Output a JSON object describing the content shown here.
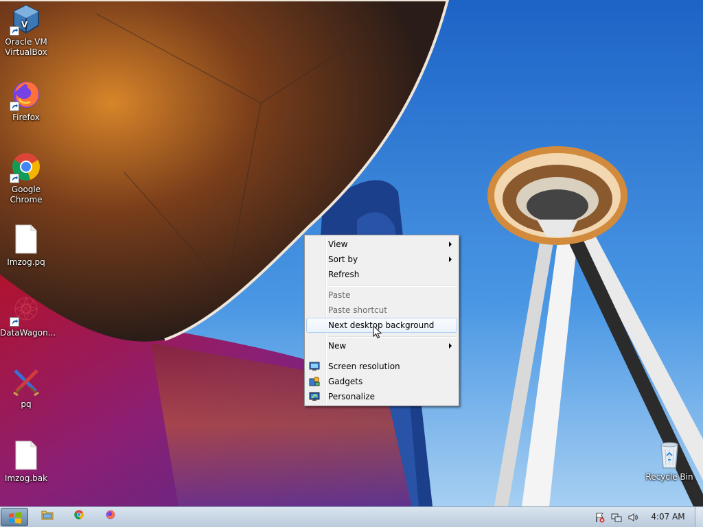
{
  "desktop": {
    "icons": [
      {
        "label_lines": [
          "Oracle VM",
          "VirtualBox"
        ],
        "icon": "virtualbox-icon",
        "shortcut": true
      },
      {
        "label_lines": [
          "Firefox"
        ],
        "icon": "firefox-icon",
        "shortcut": true
      },
      {
        "label_lines": [
          "Google",
          "Chrome"
        ],
        "icon": "chrome-icon",
        "shortcut": true
      },
      {
        "label_lines": [
          "Imzog.pq"
        ],
        "icon": "file-icon",
        "shortcut": false
      },
      {
        "label_lines": [
          "DataWagon..."
        ],
        "icon": "datawagon-icon",
        "shortcut": true
      },
      {
        "label_lines": [
          "pq"
        ],
        "icon": "pq-swords-icon",
        "shortcut": false
      },
      {
        "label_lines": [
          "Imzog.bak"
        ],
        "icon": "file-icon",
        "shortcut": false
      },
      {
        "label_lines": [
          "Recycle Bin"
        ],
        "icon": "recycle-bin-icon",
        "shortcut": false
      }
    ]
  },
  "context_menu": {
    "items": [
      {
        "label": "View",
        "submenu": true,
        "enabled": true
      },
      {
        "label": "Sort by",
        "submenu": true,
        "enabled": true
      },
      {
        "label": "Refresh",
        "submenu": false,
        "enabled": true
      },
      {
        "label": "Paste",
        "submenu": false,
        "enabled": false
      },
      {
        "label": "Paste shortcut",
        "submenu": false,
        "enabled": false
      },
      {
        "label": "Next desktop background",
        "submenu": false,
        "enabled": true,
        "highlighted": true
      },
      {
        "label": "New",
        "submenu": true,
        "enabled": true
      },
      {
        "label": "Screen resolution",
        "submenu": false,
        "enabled": true,
        "icon": "monitor-icon"
      },
      {
        "label": "Gadgets",
        "submenu": false,
        "enabled": true,
        "icon": "gadgets-icon"
      },
      {
        "label": "Personalize",
        "submenu": false,
        "enabled": true,
        "icon": "personalize-icon"
      }
    ]
  },
  "taskbar": {
    "start_icon": "windows-logo-icon",
    "pinned": [
      {
        "name": "explorer",
        "icon": "folder-icon"
      },
      {
        "name": "chrome",
        "icon": "chrome-icon"
      },
      {
        "name": "firefox",
        "icon": "firefox-icon"
      }
    ],
    "tray_icons": [
      "action-center-flag-icon",
      "network-icon",
      "volume-icon"
    ],
    "clock": "4:07 AM"
  },
  "colors": {
    "sky": "#2f7fd6",
    "menu_bg": "#f0f0f0",
    "menu_highlight_border": "#aecff7",
    "taskbar": "#c8d6e5"
  }
}
